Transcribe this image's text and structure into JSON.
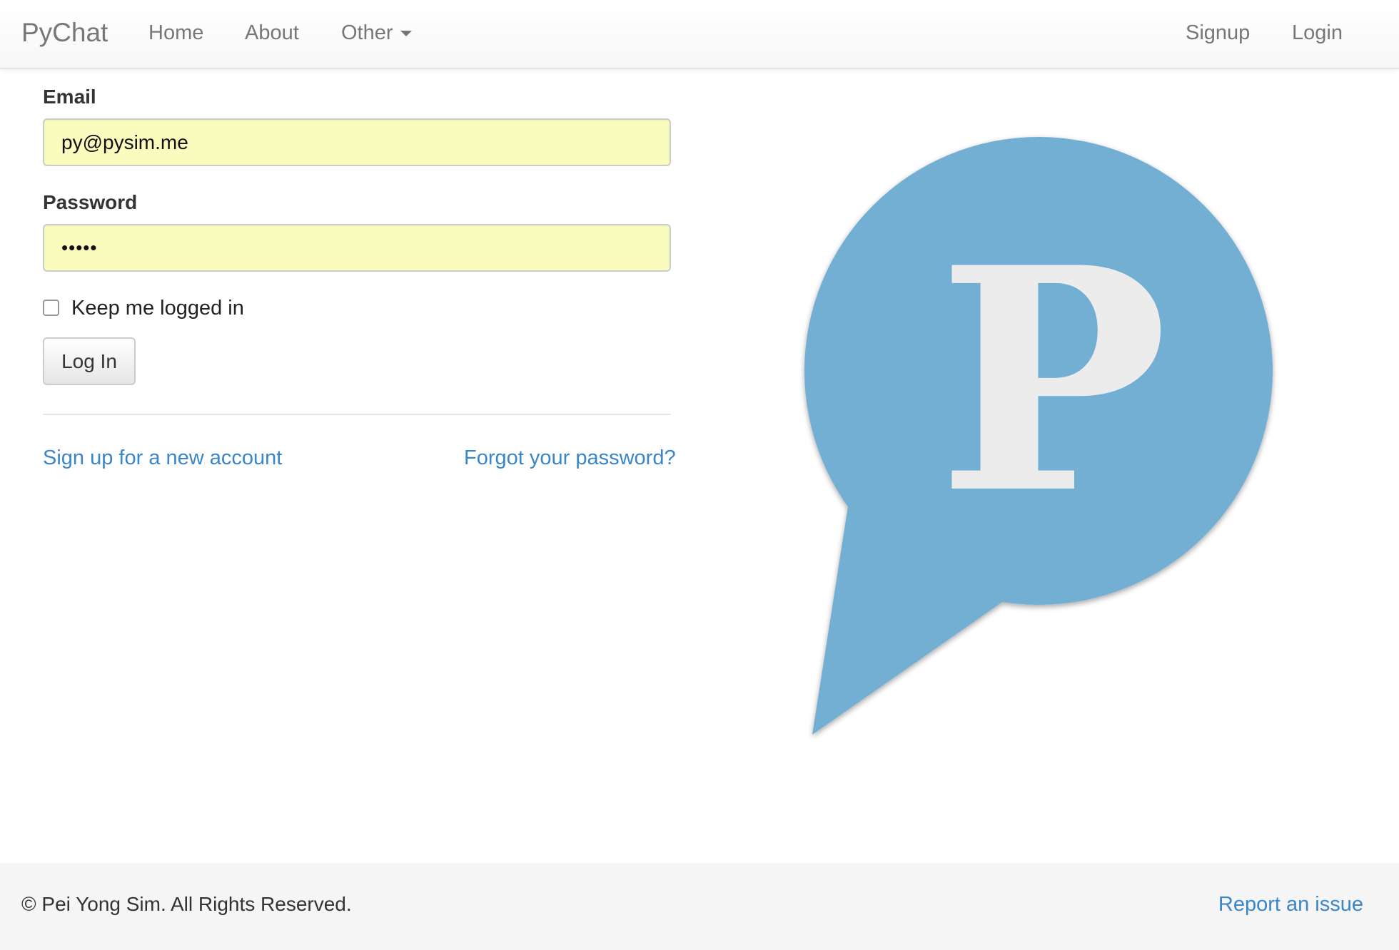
{
  "navbar": {
    "brand": "PyChat",
    "links": [
      {
        "label": "Home"
      },
      {
        "label": "About"
      },
      {
        "label": "Other"
      }
    ],
    "right_links": [
      {
        "label": "Signup"
      },
      {
        "label": "Login"
      }
    ]
  },
  "form": {
    "email_label": "Email",
    "email_value": "py@pysim.me",
    "password_label": "Password",
    "password_value": "•••••",
    "remember_label": "Keep me logged in",
    "remember_checked": false,
    "submit_label": "Log In",
    "signup_link": "Sign up for a new account",
    "forgot_link": "Forgot your password?"
  },
  "logo": {
    "letter": "P",
    "bubble_color": "#72afd3",
    "letter_color": "#ececec"
  },
  "footer": {
    "copyright": "© Pei Yong Sim. All Rights Reserved.",
    "report_link": "Report an issue"
  },
  "colors": {
    "link": "#3a86c8",
    "input_autofill": "#fafcbe",
    "nav_text": "#777777"
  }
}
